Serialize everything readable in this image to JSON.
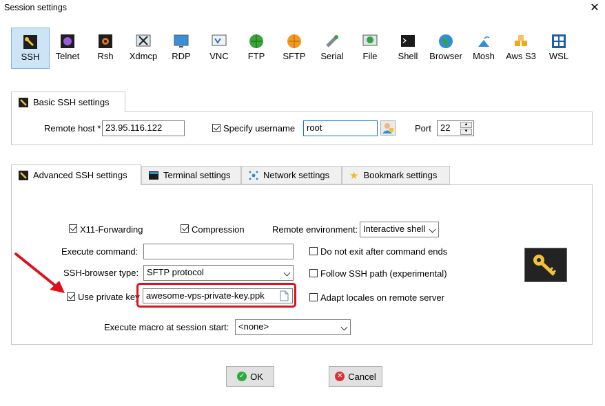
{
  "window": {
    "title": "Session settings"
  },
  "toolbar": {
    "items": [
      {
        "label": "SSH",
        "icon": "ssh-icon"
      },
      {
        "label": "Telnet",
        "icon": "telnet-icon"
      },
      {
        "label": "Rsh",
        "icon": "rsh-icon"
      },
      {
        "label": "Xdmcp",
        "icon": "xdmcp-icon"
      },
      {
        "label": "RDP",
        "icon": "rdp-icon"
      },
      {
        "label": "VNC",
        "icon": "vnc-icon"
      },
      {
        "label": "FTP",
        "icon": "ftp-icon"
      },
      {
        "label": "SFTP",
        "icon": "sftp-icon"
      },
      {
        "label": "Serial",
        "icon": "serial-icon"
      },
      {
        "label": "File",
        "icon": "file-icon"
      },
      {
        "label": "Shell",
        "icon": "shell-icon"
      },
      {
        "label": "Browser",
        "icon": "browser-icon"
      },
      {
        "label": "Mosh",
        "icon": "mosh-icon"
      },
      {
        "label": "Aws S3",
        "icon": "aws-s3-icon"
      },
      {
        "label": "WSL",
        "icon": "wsl-icon"
      }
    ]
  },
  "basic": {
    "tab_label": "Basic SSH settings",
    "remote_host_label": "Remote host *",
    "remote_host_value": "23.95.116.122",
    "specify_username_label": "Specify username",
    "username_value": "root",
    "port_label": "Port",
    "port_value": "22"
  },
  "advanced": {
    "tabs": [
      {
        "label": "Advanced SSH settings"
      },
      {
        "label": "Terminal settings"
      },
      {
        "label": "Network settings"
      },
      {
        "label": "Bookmark settings"
      }
    ],
    "x11_label": "X11-Forwarding",
    "compression_label": "Compression",
    "remote_env_label": "Remote environment:",
    "remote_env_value": "Interactive shell",
    "execute_command_label": "Execute command:",
    "execute_command_value": "",
    "do_not_exit_label": "Do not exit after command ends",
    "ssh_browser_label": "SSH-browser type:",
    "ssh_browser_value": "SFTP protocol",
    "follow_ssh_label": "Follow SSH path (experimental)",
    "use_private_key_label": "Use private key",
    "private_key_value": "awesome-vps-private-key.ppk",
    "adapt_locales_label": "Adapt locales on remote server",
    "macro_label": "Execute macro at session start:",
    "macro_value": "<none>"
  },
  "buttons": {
    "ok": "OK",
    "cancel": "Cancel"
  },
  "colors": {
    "accent": "#0078d7",
    "highlight": "#e0101a",
    "ok": "#2eaa3a",
    "cancel": "#d7323a"
  }
}
